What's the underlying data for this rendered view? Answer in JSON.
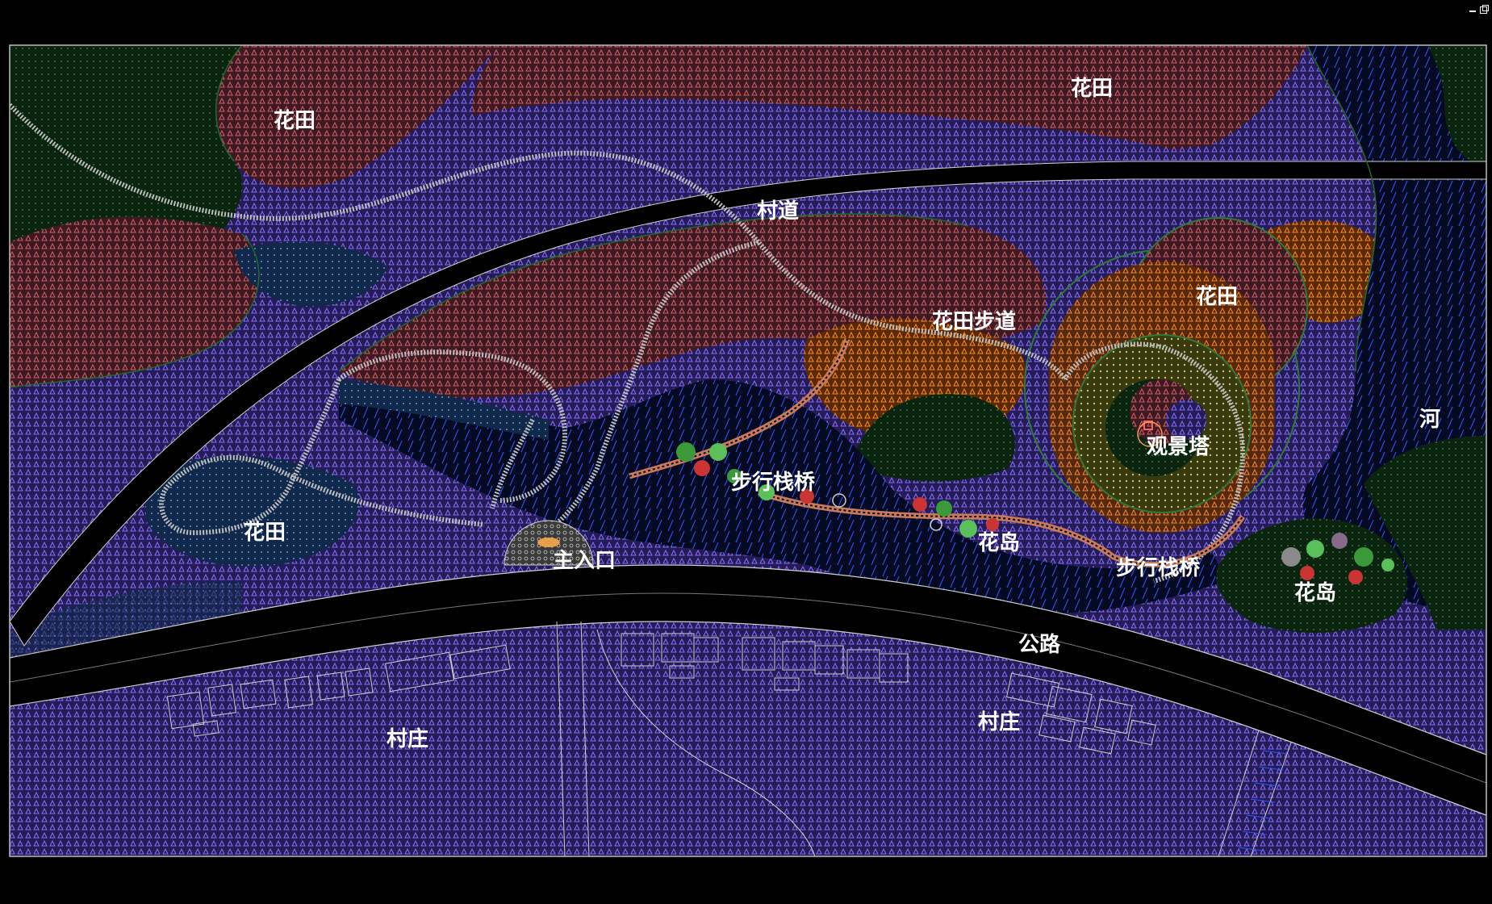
{
  "window": {
    "minimize_icon": "minimize-icon",
    "restore_icon": "restore-icon"
  },
  "colors": {
    "background": "#000000",
    "green_zone": "#0b2a12",
    "purple_zone": "#2a2260",
    "red_zone": "#4a1f26",
    "orange_zone": "#7a3a10",
    "water": "#0a1a3a",
    "water_hatch": "#2a5aff",
    "road": "#000000",
    "road_edge": "#cfcfcf",
    "path_stone": "#bdbdbd",
    "boardwalk": "#c87a5a",
    "yellow_zone": "#8a8a30"
  },
  "labels": {
    "field_top_left": "花田",
    "field_top_right": "花田",
    "village_road": "村道",
    "field_center": "花田",
    "field_path": "花田步道",
    "river": "河",
    "tower": "观景塔",
    "boardwalk_1": "步行栈桥",
    "boardwalk_2": "步行栈桥",
    "field_left": "花田",
    "main_entrance": "主入口",
    "island_1": "花岛",
    "island_2": "花岛",
    "highway": "公路",
    "village_left": "村庄",
    "village_right": "村庄"
  }
}
